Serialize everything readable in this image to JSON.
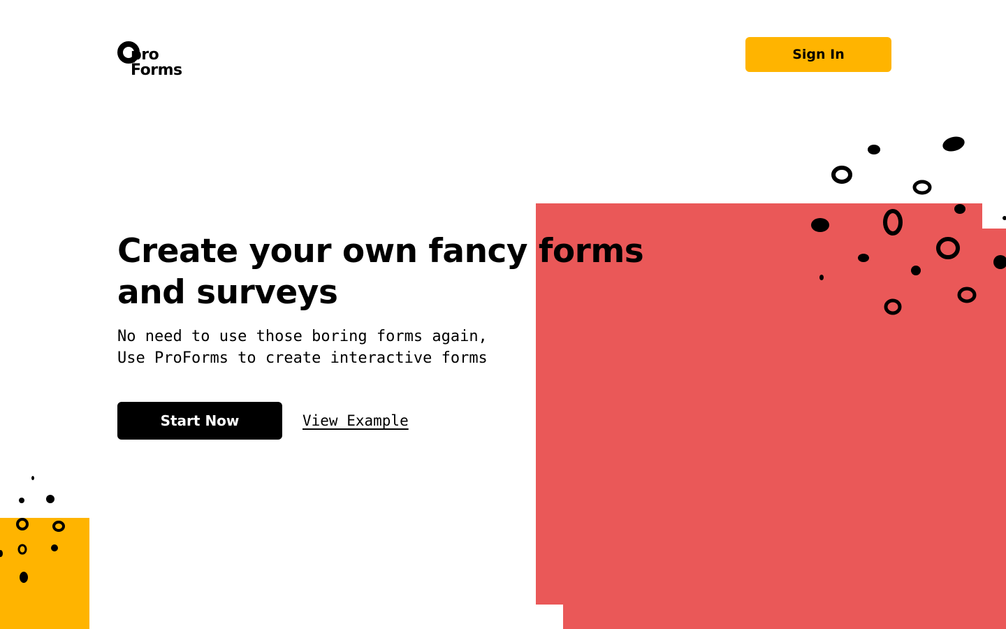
{
  "brand": {
    "logo_line1": "pro",
    "logo_line2": "Forms"
  },
  "header": {
    "signin_label": "Sign In"
  },
  "hero": {
    "headline": "Create your own fancy forms and surveys",
    "subtext_line1": "No need to use those boring forms again,",
    "subtext_line2": "Use ProForms to create interactive forms",
    "primary_cta": "Start Now",
    "secondary_cta": "View Example"
  },
  "colors": {
    "accent_yellow": "#FFB400",
    "accent_red": "#EA5858",
    "text": "#000000",
    "background": "#FFFFFF"
  }
}
